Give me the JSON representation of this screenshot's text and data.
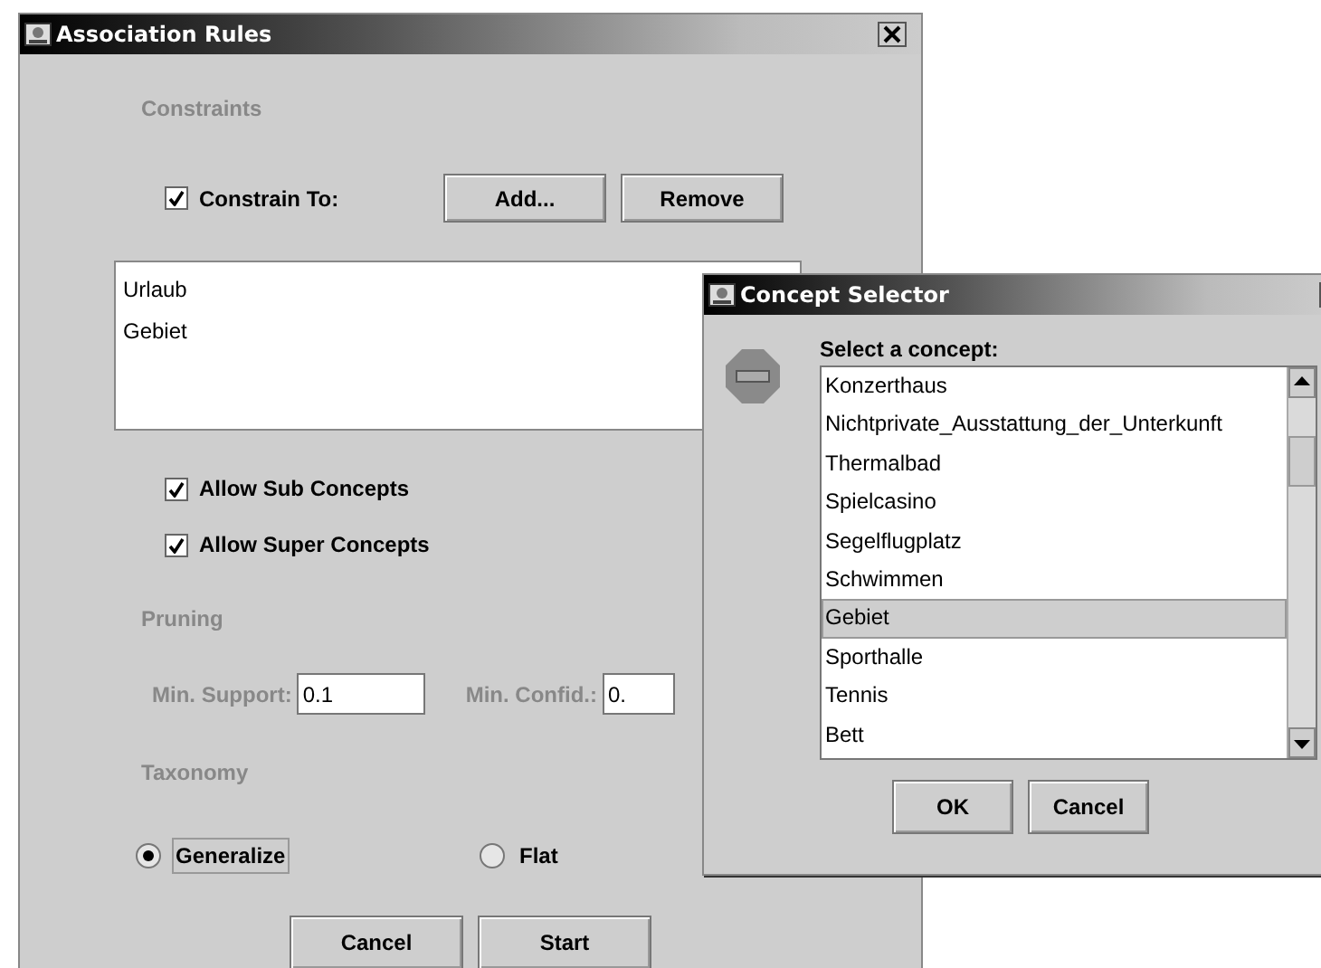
{
  "window": {
    "title": "Association Rules"
  },
  "constraints": {
    "heading": "Constraints",
    "constrain_to": {
      "label": "Constrain To:",
      "checked": true
    },
    "buttons": [
      "Add...",
      "Remove"
    ],
    "concepts": [
      "Urlaub",
      "Gebiet"
    ],
    "options": [
      {
        "label": "Allow Sub Concepts",
        "checked": true
      },
      {
        "label": "Allow Super Concepts",
        "checked": true
      }
    ]
  },
  "pruning": {
    "heading": "Pruning",
    "fields": [
      {
        "label": "Min. Support:",
        "value": "0.1"
      },
      {
        "label": "Min. Confid.:",
        "value": "0."
      }
    ]
  },
  "taxonomy": {
    "heading": "Taxonomy",
    "options": [
      {
        "label": "Generalize",
        "selected": true
      },
      {
        "label": "Flat",
        "selected": false
      }
    ]
  },
  "buttons": [
    "Cancel",
    "Start"
  ],
  "dialog": {
    "title": "Concept Selector",
    "prompt": "Select a concept:",
    "items": [
      {
        "label": "Konzerthaus",
        "selected": false
      },
      {
        "label": "Nichtprivate_Ausstattung_der_Unterkunft",
        "selected": false
      },
      {
        "label": "Thermalbad",
        "selected": false
      },
      {
        "label": "Spielcasino",
        "selected": false
      },
      {
        "label": "Segelflugplatz",
        "selected": false
      },
      {
        "label": "Schwimmen",
        "selected": false
      },
      {
        "label": "Gebiet",
        "selected": true
      },
      {
        "label": "Sporthalle",
        "selected": false
      },
      {
        "label": "Tennis",
        "selected": false
      },
      {
        "label": "Bett",
        "selected": false
      }
    ],
    "buttons": [
      "OK",
      "Cancel"
    ]
  }
}
